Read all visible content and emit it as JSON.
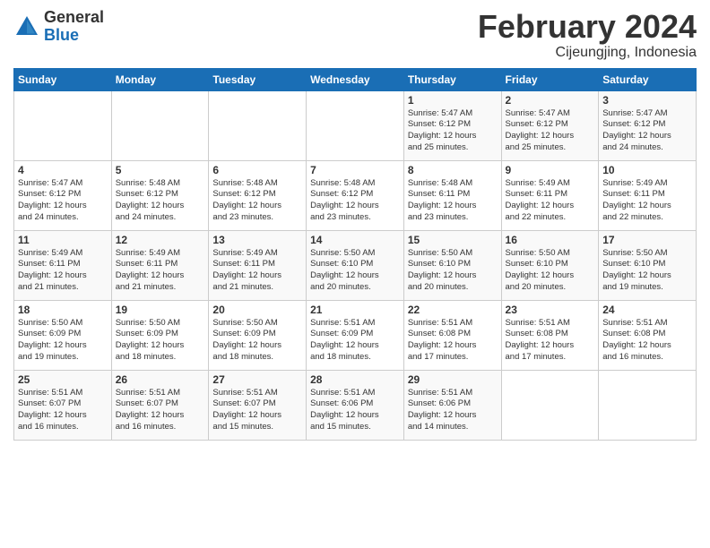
{
  "logo": {
    "general": "General",
    "blue": "Blue"
  },
  "header": {
    "month": "February 2024",
    "location": "Cijeungjing, Indonesia"
  },
  "weekdays": [
    "Sunday",
    "Monday",
    "Tuesday",
    "Wednesday",
    "Thursday",
    "Friday",
    "Saturday"
  ],
  "weeks": [
    [
      {
        "day": "",
        "info": ""
      },
      {
        "day": "",
        "info": ""
      },
      {
        "day": "",
        "info": ""
      },
      {
        "day": "",
        "info": ""
      },
      {
        "day": "1",
        "info": "Sunrise: 5:47 AM\nSunset: 6:12 PM\nDaylight: 12 hours\nand 25 minutes."
      },
      {
        "day": "2",
        "info": "Sunrise: 5:47 AM\nSunset: 6:12 PM\nDaylight: 12 hours\nand 25 minutes."
      },
      {
        "day": "3",
        "info": "Sunrise: 5:47 AM\nSunset: 6:12 PM\nDaylight: 12 hours\nand 24 minutes."
      }
    ],
    [
      {
        "day": "4",
        "info": "Sunrise: 5:47 AM\nSunset: 6:12 PM\nDaylight: 12 hours\nand 24 minutes."
      },
      {
        "day": "5",
        "info": "Sunrise: 5:48 AM\nSunset: 6:12 PM\nDaylight: 12 hours\nand 24 minutes."
      },
      {
        "day": "6",
        "info": "Sunrise: 5:48 AM\nSunset: 6:12 PM\nDaylight: 12 hours\nand 23 minutes."
      },
      {
        "day": "7",
        "info": "Sunrise: 5:48 AM\nSunset: 6:12 PM\nDaylight: 12 hours\nand 23 minutes."
      },
      {
        "day": "8",
        "info": "Sunrise: 5:48 AM\nSunset: 6:11 PM\nDaylight: 12 hours\nand 23 minutes."
      },
      {
        "day": "9",
        "info": "Sunrise: 5:49 AM\nSunset: 6:11 PM\nDaylight: 12 hours\nand 22 minutes."
      },
      {
        "day": "10",
        "info": "Sunrise: 5:49 AM\nSunset: 6:11 PM\nDaylight: 12 hours\nand 22 minutes."
      }
    ],
    [
      {
        "day": "11",
        "info": "Sunrise: 5:49 AM\nSunset: 6:11 PM\nDaylight: 12 hours\nand 21 minutes."
      },
      {
        "day": "12",
        "info": "Sunrise: 5:49 AM\nSunset: 6:11 PM\nDaylight: 12 hours\nand 21 minutes."
      },
      {
        "day": "13",
        "info": "Sunrise: 5:49 AM\nSunset: 6:11 PM\nDaylight: 12 hours\nand 21 minutes."
      },
      {
        "day": "14",
        "info": "Sunrise: 5:50 AM\nSunset: 6:10 PM\nDaylight: 12 hours\nand 20 minutes."
      },
      {
        "day": "15",
        "info": "Sunrise: 5:50 AM\nSunset: 6:10 PM\nDaylight: 12 hours\nand 20 minutes."
      },
      {
        "day": "16",
        "info": "Sunrise: 5:50 AM\nSunset: 6:10 PM\nDaylight: 12 hours\nand 20 minutes."
      },
      {
        "day": "17",
        "info": "Sunrise: 5:50 AM\nSunset: 6:10 PM\nDaylight: 12 hours\nand 19 minutes."
      }
    ],
    [
      {
        "day": "18",
        "info": "Sunrise: 5:50 AM\nSunset: 6:09 PM\nDaylight: 12 hours\nand 19 minutes."
      },
      {
        "day": "19",
        "info": "Sunrise: 5:50 AM\nSunset: 6:09 PM\nDaylight: 12 hours\nand 18 minutes."
      },
      {
        "day": "20",
        "info": "Sunrise: 5:50 AM\nSunset: 6:09 PM\nDaylight: 12 hours\nand 18 minutes."
      },
      {
        "day": "21",
        "info": "Sunrise: 5:51 AM\nSunset: 6:09 PM\nDaylight: 12 hours\nand 18 minutes."
      },
      {
        "day": "22",
        "info": "Sunrise: 5:51 AM\nSunset: 6:08 PM\nDaylight: 12 hours\nand 17 minutes."
      },
      {
        "day": "23",
        "info": "Sunrise: 5:51 AM\nSunset: 6:08 PM\nDaylight: 12 hours\nand 17 minutes."
      },
      {
        "day": "24",
        "info": "Sunrise: 5:51 AM\nSunset: 6:08 PM\nDaylight: 12 hours\nand 16 minutes."
      }
    ],
    [
      {
        "day": "25",
        "info": "Sunrise: 5:51 AM\nSunset: 6:07 PM\nDaylight: 12 hours\nand 16 minutes."
      },
      {
        "day": "26",
        "info": "Sunrise: 5:51 AM\nSunset: 6:07 PM\nDaylight: 12 hours\nand 16 minutes."
      },
      {
        "day": "27",
        "info": "Sunrise: 5:51 AM\nSunset: 6:07 PM\nDaylight: 12 hours\nand 15 minutes."
      },
      {
        "day": "28",
        "info": "Sunrise: 5:51 AM\nSunset: 6:06 PM\nDaylight: 12 hours\nand 15 minutes."
      },
      {
        "day": "29",
        "info": "Sunrise: 5:51 AM\nSunset: 6:06 PM\nDaylight: 12 hours\nand 14 minutes."
      },
      {
        "day": "",
        "info": ""
      },
      {
        "day": "",
        "info": ""
      }
    ]
  ]
}
